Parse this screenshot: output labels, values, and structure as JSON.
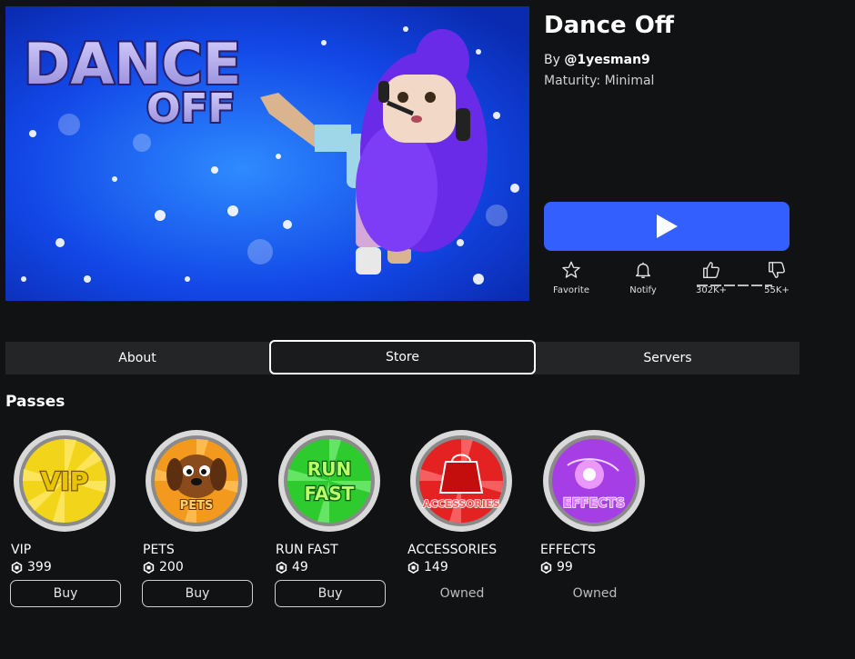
{
  "game": {
    "title": "Dance Off",
    "by_prefix": "By",
    "creator": "@1yesman9",
    "maturity": "Maturity: Minimal",
    "thumbnail_text_1": "DANCE",
    "thumbnail_text_2": "OFF"
  },
  "actions": {
    "favorite": "Favorite",
    "notify": "Notify",
    "likes": "302K+",
    "dislikes": "55K+"
  },
  "tabs": [
    {
      "label": "About",
      "active": false
    },
    {
      "label": "Store",
      "active": true
    },
    {
      "label": "Servers",
      "active": false
    }
  ],
  "section": {
    "title": "Passes"
  },
  "passes": [
    {
      "name": "VIP",
      "price": "399",
      "action": "Buy",
      "badge_text": "VIP",
      "color": "#f2d51a"
    },
    {
      "name": "PETS",
      "price": "200",
      "action": "Buy",
      "badge_text": "PETS",
      "color": "#f39a1e"
    },
    {
      "name": "RUN FAST",
      "price": "49",
      "action": "Buy",
      "badge_text": "RUN FAST",
      "color": "#2ecb2e"
    },
    {
      "name": "ACCESSORIES",
      "price": "149",
      "action": "Owned",
      "badge_text": "ACCESSORIES",
      "color": "#e42222"
    },
    {
      "name": "EFFECTS",
      "price": "99",
      "action": "Owned",
      "badge_text": "EFFECTS",
      "color": "#a63ee6"
    }
  ],
  "colors": {
    "accent": "#335fff",
    "background": "#111214",
    "tab_bar": "#232527"
  }
}
